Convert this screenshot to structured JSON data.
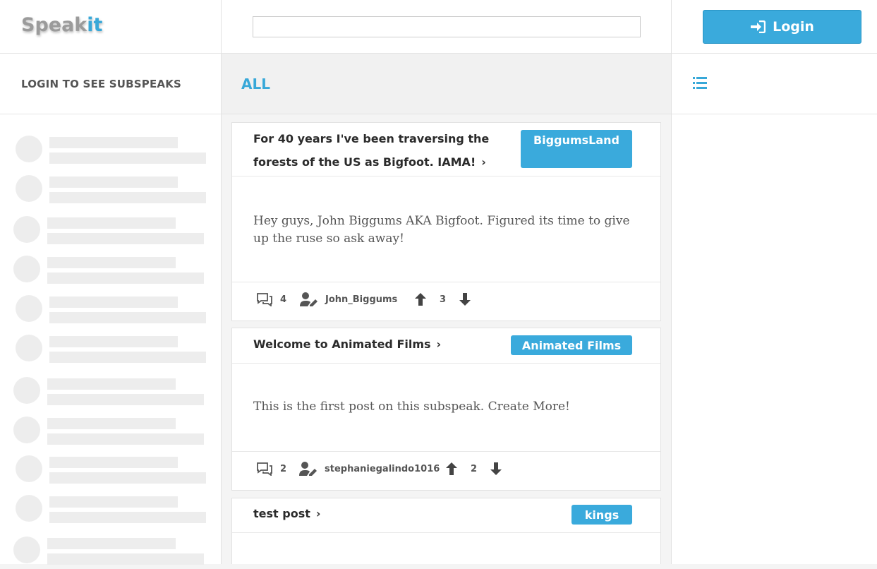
{
  "app": {
    "logo_main": "Speak",
    "logo_accent": "it",
    "accent_color": "#3aaadc"
  },
  "header": {
    "search_placeholder": "",
    "login_label": "Login"
  },
  "subbar": {
    "left_label": "LOGIN TO SEE SUBSPEAKS",
    "tab_label": "ALL"
  },
  "posts": [
    {
      "title": "For 40 years I've been traversing the forests of the US as Bigfoot. IAMA!",
      "subspeak": "BiggumsLand",
      "body": "Hey guys, John Biggums AKA Bigfoot. Figured its time to give up the ruse so ask away!",
      "comments": "4",
      "author": "John_Biggums",
      "votes": "3"
    },
    {
      "title": "Welcome to Animated Films",
      "subspeak": "Animated Films",
      "body": "This is the first post on this subspeak. Create More!",
      "comments": "2",
      "author": "stephaniegalindo1016",
      "votes": "2"
    },
    {
      "title": "test post",
      "subspeak": "kings",
      "body": "",
      "comments": "",
      "author": "",
      "votes": ""
    }
  ]
}
